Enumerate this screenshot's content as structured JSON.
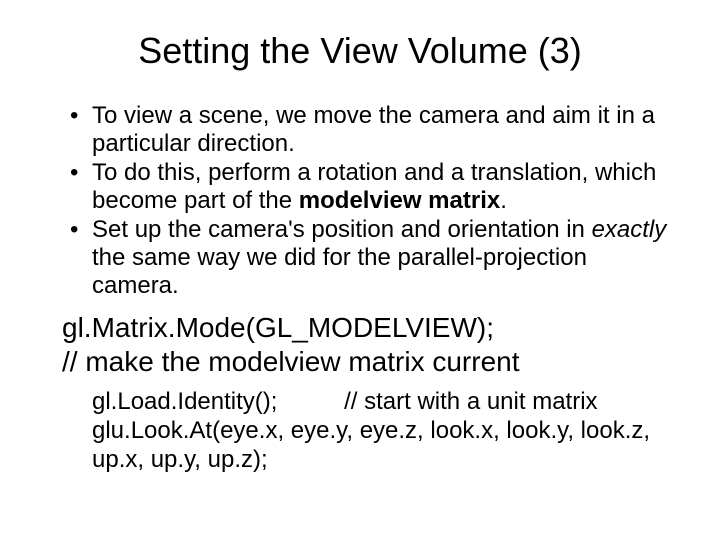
{
  "title": "Setting the View Volume (3)",
  "bullets": {
    "b1": {
      "text": "To view a scene, we move the camera and aim it in a particular direction."
    },
    "b2": {
      "part1": "To do this, perform a rotation and a translation, which become part of the ",
      "bold": "modelview matrix",
      "part2": "."
    },
    "b3": {
      "part1": "Set up the camera's position and orientation in ",
      "italic": "exactly",
      "part2": " the same way we did for the parallel-projection camera."
    }
  },
  "code1": {
    "line1": "gl.Matrix.Mode(GL_MODELVIEW);",
    "line2": " // make the modelview matrix current"
  },
  "code2": {
    "line1a": "gl.Load.Identity();",
    "line1b": "// start with a unit matrix",
    "line2": "glu.Look.At(eye.x, eye.y, eye.z, look.x, look.y, look.z, up.x, up.y, up.z);"
  }
}
